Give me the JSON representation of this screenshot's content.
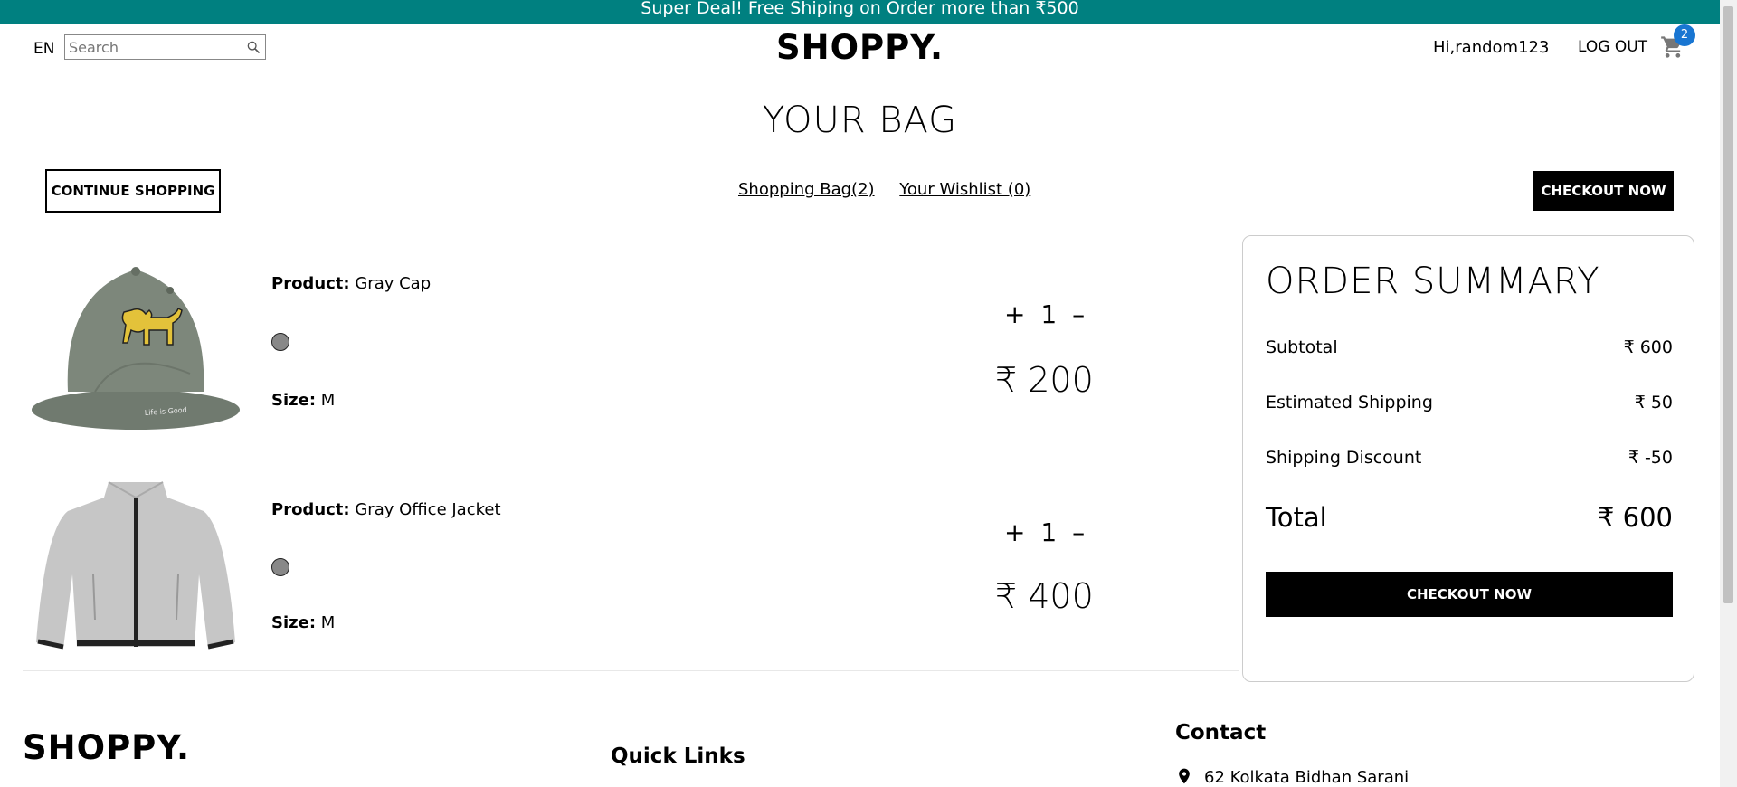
{
  "announcement": "Super Deal! Free Shiping on Order more than ₹500",
  "nav": {
    "lang": "EN",
    "search_placeholder": "Search",
    "logo": "SHOPPY.",
    "greeting": "Hi,random123",
    "logout": "LOG OUT",
    "cart_count": "2"
  },
  "bag": {
    "title": "YOUR BAG",
    "continue_label": "CONTINUE SHOPPING",
    "bag_link": "Shopping Bag(2)",
    "wishlist_link": "Your Wishlist (0)",
    "checkout_top": "CHECKOUT NOW"
  },
  "products": [
    {
      "product_label": "Product:",
      "name": "Gray Cap",
      "color": "#888888",
      "size_label": "Size:",
      "size": "M",
      "plus": "+",
      "qty": "1",
      "minus": "–",
      "price": "₹ 200"
    },
    {
      "product_label": "Product:",
      "name": "Gray Office Jacket",
      "color": "#888888",
      "size_label": "Size:",
      "size": "M",
      "plus": "+",
      "qty": "1",
      "minus": "–",
      "price": "₹ 400"
    }
  ],
  "summary": {
    "title": "ORDER SUMMARY",
    "rows": [
      {
        "label": "Subtotal",
        "value": "₹ 600"
      },
      {
        "label": "Estimated Shipping",
        "value": "₹ 50"
      },
      {
        "label": "Shipping Discount",
        "value": "₹ -50"
      },
      {
        "label": "Total",
        "value": "₹ 600"
      }
    ],
    "checkout": "CHECKOUT NOW"
  },
  "footer": {
    "logo": "SHOPPY.",
    "quick_links": "Quick Links",
    "contact": "Contact",
    "address": "62 Kolkata Bidhan Sarani"
  },
  "colors": {
    "accent": "#008080",
    "badge": "#1976d2"
  }
}
